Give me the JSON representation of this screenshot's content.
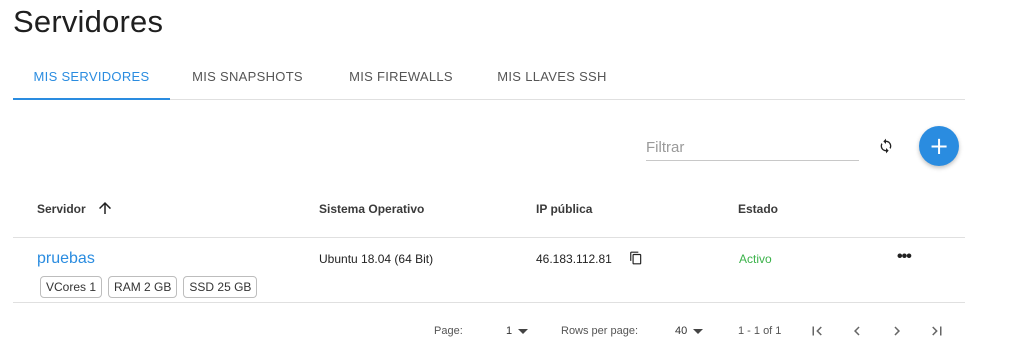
{
  "page": {
    "title": "Servidores"
  },
  "tabs": [
    {
      "label": "MIS SERVIDORES",
      "active": true
    },
    {
      "label": "MIS SNAPSHOTS",
      "active": false
    },
    {
      "label": "MIS FIREWALLS",
      "active": false
    },
    {
      "label": "MIS LLAVES SSH",
      "active": false
    }
  ],
  "toolbar": {
    "filter_placeholder": "Filtrar",
    "refresh_icon": "refresh-icon",
    "add_icon": "plus-icon",
    "add_symbol": "+"
  },
  "table": {
    "headers": {
      "server": "Servidor",
      "os": "Sistema Operativo",
      "ip": "IP pública",
      "status": "Estado"
    },
    "sort": {
      "column": "server",
      "direction": "asc",
      "icon": "arrow-up-icon"
    },
    "rows": [
      {
        "name": "pruebas",
        "specs": [
          "VCores 1",
          "RAM 2 GB",
          "SSD 25 GB"
        ],
        "os": "Ubuntu 18.04 (64 Bit)",
        "ip": "46.183.112.81",
        "status": "Activo",
        "actions": "•••"
      }
    ]
  },
  "pagination": {
    "page_label": "Page:",
    "page_value": "1",
    "rows_label": "Rows per page:",
    "rows_value": "40",
    "range": "1 - 1 of 1"
  },
  "colors": {
    "accent": "#2a8ce0",
    "status_active": "#3bb24a"
  }
}
